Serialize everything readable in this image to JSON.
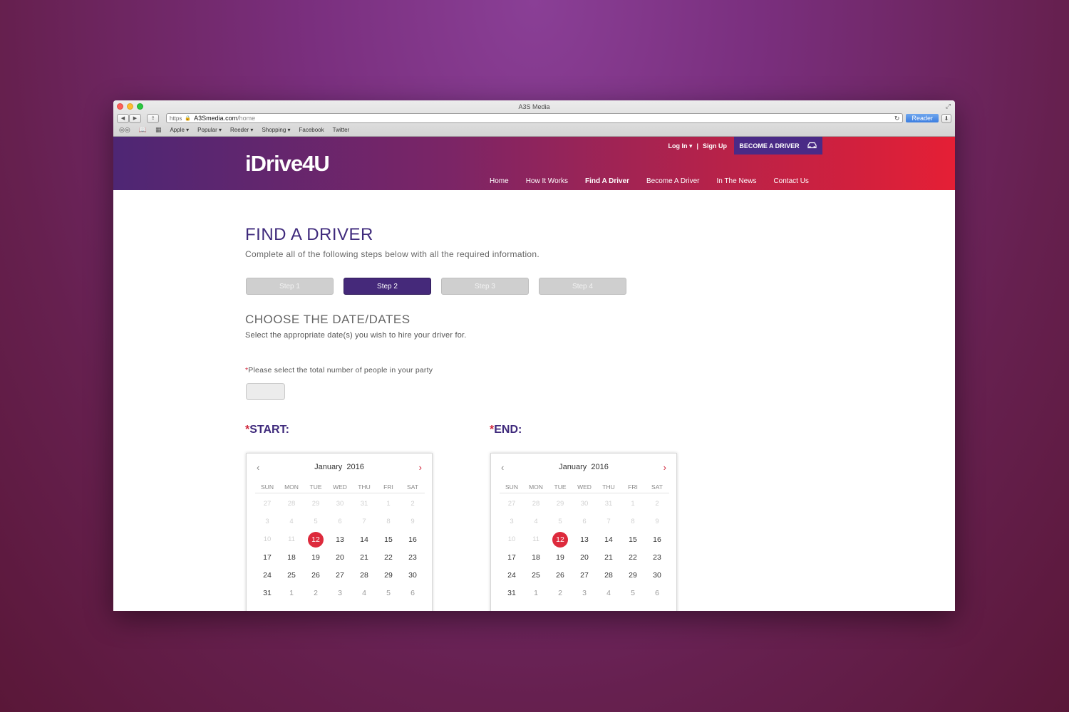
{
  "browser": {
    "window_title": "A3S Media",
    "url_scheme": "https",
    "url_domain": "A3Smedia.com",
    "url_path": "/home",
    "reader_label": "Reader",
    "bookmarks": [
      "Apple ▾",
      "Popular ▾",
      "Reeder ▾",
      "Shopping ▾",
      "Facebook",
      "Twitter"
    ]
  },
  "site": {
    "logo": "iDrive4U",
    "login": "Log In ▾",
    "separator": "|",
    "signup": "Sign Up",
    "become_driver_btn": "BECOME A DRIVER",
    "nav": [
      "Home",
      "How It Works",
      "Find A Driver",
      "Become A Driver",
      "In The News",
      "Contact Us"
    ],
    "active_nav": "Find A Driver",
    "colors": {
      "brand_purple": "#45297a",
      "brand_red": "#e51f35"
    }
  },
  "page": {
    "title": "FIND A DRIVER",
    "subtitle": "Complete all of the following steps below with all the required information.",
    "steps": [
      "Step 1",
      "Step 2",
      "Step 3",
      "Step 4"
    ],
    "active_step": "Step 2",
    "section_title": "CHOOSE THE DATE/DATES",
    "section_subtitle": "Select the appropriate date(s) you wish to hire your driver for.",
    "party_label": "Please select the total number of people in your party",
    "party_value": ""
  },
  "calendars": {
    "start": {
      "label": "START:",
      "month": "January",
      "year": "2016",
      "selected": "12"
    },
    "end": {
      "label": "END:",
      "month": "January",
      "year": "2016",
      "selected": "12"
    },
    "weekdays": [
      "SUN",
      "MON",
      "TUE",
      "WED",
      "THU",
      "FRI",
      "SAT"
    ],
    "weeks": [
      [
        [
          "27",
          "muted"
        ],
        [
          "28",
          "muted"
        ],
        [
          "29",
          "muted"
        ],
        [
          "30",
          "muted"
        ],
        [
          "31",
          "muted"
        ],
        [
          "1",
          "muted"
        ],
        [
          "2",
          "muted"
        ]
      ],
      [
        [
          "3",
          "muted"
        ],
        [
          "4",
          "muted"
        ],
        [
          "5",
          "muted"
        ],
        [
          "6",
          "muted"
        ],
        [
          "7",
          "muted"
        ],
        [
          "8",
          "muted"
        ],
        [
          "9",
          "muted"
        ]
      ],
      [
        [
          "10",
          "muted"
        ],
        [
          "11",
          "muted"
        ],
        [
          "12",
          "sel"
        ],
        [
          "13",
          ""
        ],
        [
          "14",
          ""
        ],
        [
          "15",
          ""
        ],
        [
          "16",
          ""
        ]
      ],
      [
        [
          "17",
          ""
        ],
        [
          "18",
          ""
        ],
        [
          "19",
          ""
        ],
        [
          "20",
          ""
        ],
        [
          "21",
          ""
        ],
        [
          "22",
          ""
        ],
        [
          "23",
          ""
        ]
      ],
      [
        [
          "24",
          ""
        ],
        [
          "25",
          ""
        ],
        [
          "26",
          ""
        ],
        [
          "27",
          ""
        ],
        [
          "28",
          ""
        ],
        [
          "29",
          ""
        ],
        [
          "30",
          ""
        ]
      ],
      [
        [
          "31",
          ""
        ],
        [
          "1",
          "dim"
        ],
        [
          "2",
          "dim"
        ],
        [
          "3",
          "dim"
        ],
        [
          "4",
          "dim"
        ],
        [
          "5",
          "dim"
        ],
        [
          "6",
          "dim"
        ]
      ]
    ]
  }
}
